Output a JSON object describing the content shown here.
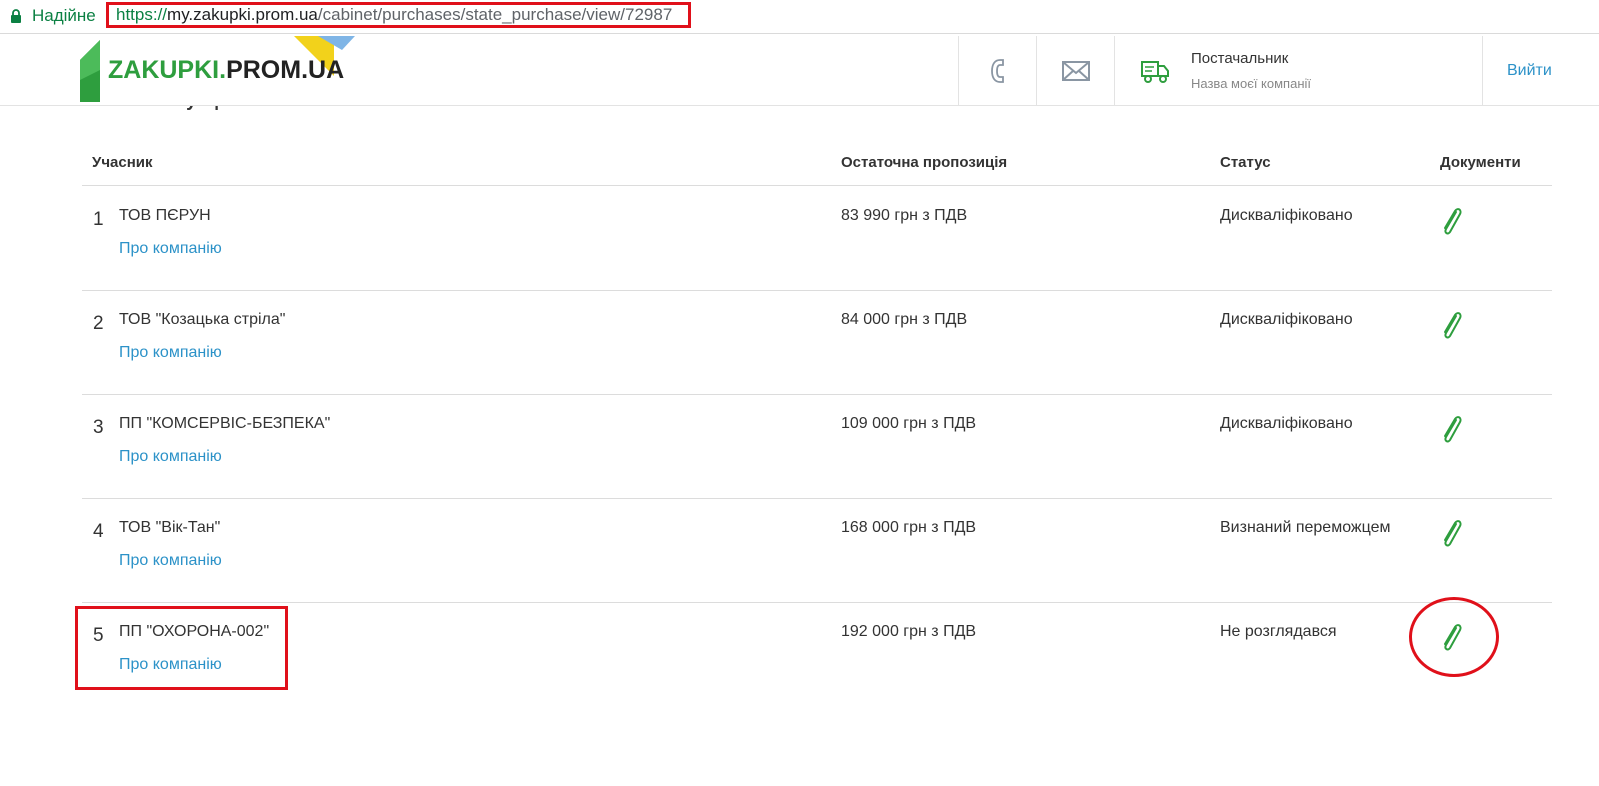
{
  "browser": {
    "secure_label": "Надійне",
    "url_scheme": "https://",
    "url_host": "my.zakupki.prom.ua",
    "url_path": "/cabinet/purchases/state_purchase/view/72987"
  },
  "header": {
    "logo_green": "ZAKUPKI.",
    "logo_dark": "PROM.UA",
    "phone_icon": "phone-icon",
    "mail_icon": "mail-icon",
    "truck_icon": "truck-icon",
    "role": "Постачальник",
    "company_name": "Назва моєї компанії",
    "logout": "Вийти"
  },
  "section": {
    "title": "Учасники аукціона"
  },
  "table": {
    "columns": {
      "participant": "Учасник",
      "final_offer": "Остаточна пропозиція",
      "status": "Статус",
      "documents": "Документи"
    },
    "rows": [
      {
        "num": "1",
        "company": "ТОВ ПЄРУН",
        "about": "Про компанію",
        "offer": "83 990 грн з ПДВ",
        "status": "Дискваліфіковано"
      },
      {
        "num": "2",
        "company": "ТОВ \"Козацька стріла\"",
        "about": "Про компанію",
        "offer": "84 000 грн з ПДВ",
        "status": "Дискваліфіковано"
      },
      {
        "num": "3",
        "company": "ПП \"КОМСЕРВІС-БЕЗПЕКА\"",
        "about": "Про компанію",
        "offer": "109 000 грн з ПДВ",
        "status": "Дискваліфіковано"
      },
      {
        "num": "4",
        "company": "ТОВ \"Вік-Тан\"",
        "about": "Про компанію",
        "offer": "168 000 грн з ПДВ",
        "status": "Визнаний переможцем"
      },
      {
        "num": "5",
        "company": "ПП \"ОХОРОНА-002\"",
        "about": "Про компанію",
        "offer": "192 000 грн з ПДВ",
        "status": "Не розглядався"
      }
    ]
  },
  "colors": {
    "brand_green": "#2e9e3e",
    "link_blue": "#2c92c8",
    "annotation_red": "#e0101a"
  }
}
